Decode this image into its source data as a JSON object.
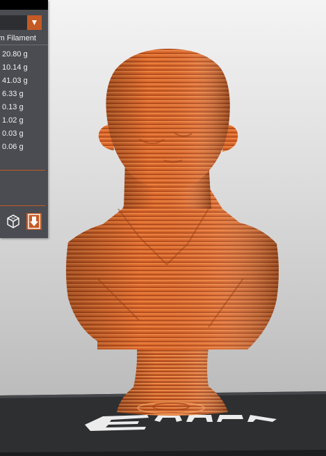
{
  "panel": {
    "header": "m Filament",
    "weights": [
      "20.80 g",
      "10.14 g",
      "41.03 g",
      "6.33 g",
      "0.13 g",
      "1.02 g",
      "0.03 g",
      "0.06 g"
    ],
    "accent_color": "#c45a24"
  },
  "scene": {
    "model_color": "#d9662a",
    "build_plate_logo": "Ender"
  },
  "icons": {
    "combo_arrow": "triangle-down-icon",
    "view": "cube-icon",
    "save": "save-to-disk-icon"
  }
}
